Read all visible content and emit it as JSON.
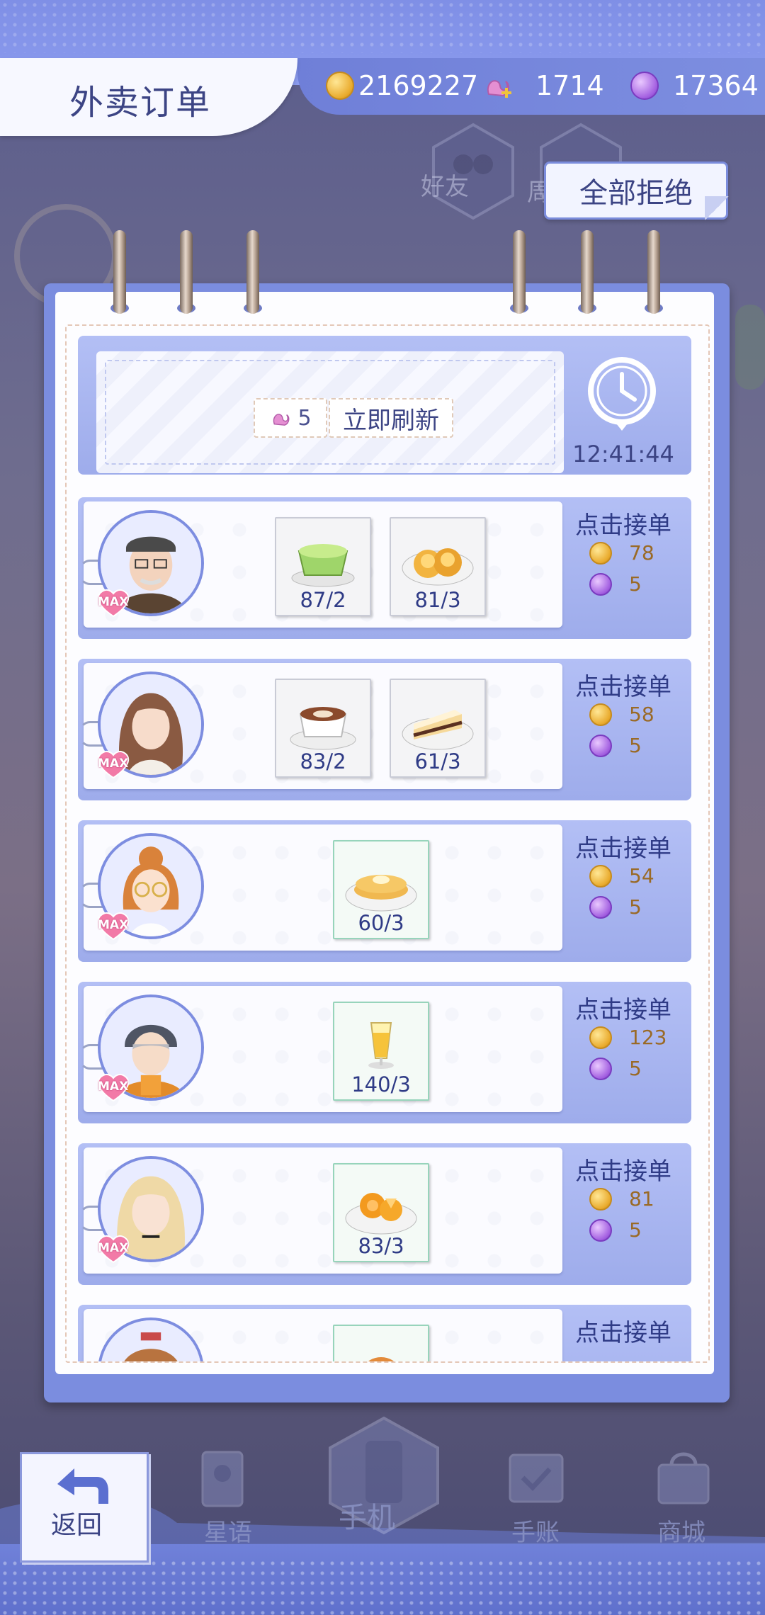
{
  "header": {
    "title": "外卖订单"
  },
  "resources": [
    {
      "icon": "gold-coin-icon",
      "value": "2169227"
    },
    {
      "icon": "pink-swan-plus-icon",
      "value": "1714"
    },
    {
      "icon": "purple-gem-icon",
      "value": "17364"
    }
  ],
  "reject_all_label": "全部拒绝",
  "background_labels": {
    "friends": "好友",
    "partial": "周"
  },
  "refresh": {
    "cost": "5",
    "button_label": "立即刷新",
    "timer": "12:41:44"
  },
  "orders": [
    {
      "badge": "MAX",
      "items": [
        {
          "icon": "green-tea-icon",
          "count": "87/2"
        },
        {
          "icon": "honey-muffin-icon",
          "count": "81/3"
        }
      ],
      "accept_label": "点击接单",
      "coin_reward": "78",
      "gem_reward": "5"
    },
    {
      "badge": "MAX",
      "items": [
        {
          "icon": "latte-icon",
          "count": "83/2"
        },
        {
          "icon": "cheesecake-slice-icon",
          "count": "61/3"
        }
      ],
      "accept_label": "点击接单",
      "coin_reward": "58",
      "gem_reward": "5"
    },
    {
      "badge": "MAX",
      "items": [
        {
          "icon": "pancake-icon",
          "count": "60/3"
        }
      ],
      "accept_label": "点击接单",
      "coin_reward": "54",
      "gem_reward": "5"
    },
    {
      "badge": "MAX",
      "items": [
        {
          "icon": "juice-glass-icon",
          "count": "140/3"
        }
      ],
      "accept_label": "点击接单",
      "coin_reward": "123",
      "gem_reward": "5"
    },
    {
      "badge": "MAX",
      "items": [
        {
          "icon": "orange-plate-icon",
          "count": "83/3"
        }
      ],
      "accept_label": "点击接单",
      "coin_reward": "81",
      "gem_reward": "5"
    },
    {
      "items": [],
      "accept_label": "点击接单"
    }
  ],
  "nav": {
    "back": "返回",
    "stars": "星语",
    "phone": "手机",
    "planner": "手账",
    "shop": "商城"
  },
  "colors": {
    "accent": "#7b8ddf",
    "text": "#2f3b86",
    "reward": "#9a6a26"
  }
}
